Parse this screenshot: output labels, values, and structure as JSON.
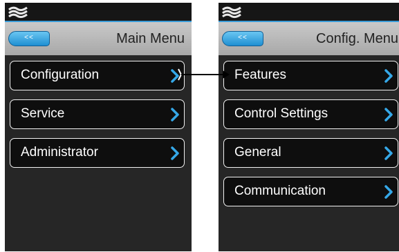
{
  "left_screen": {
    "back_label": "<<",
    "title": "Main Menu",
    "items": [
      {
        "label": "Configuration"
      },
      {
        "label": "Service"
      },
      {
        "label": "Administrator"
      }
    ]
  },
  "right_screen": {
    "back_label": "<<",
    "title": "Config. Menu",
    "items": [
      {
        "label": "Features"
      },
      {
        "label": "Control Settings"
      },
      {
        "label": "General"
      },
      {
        "label": "Communication"
      }
    ]
  },
  "colors": {
    "accent": "#3a9cd8",
    "screen_bg": "#262626",
    "header_bg": "#b8b8b8",
    "item_border": "#f2f2f2"
  },
  "icons": [
    "logo-icon",
    "chevron-right-icon",
    "arrow-right-icon"
  ]
}
